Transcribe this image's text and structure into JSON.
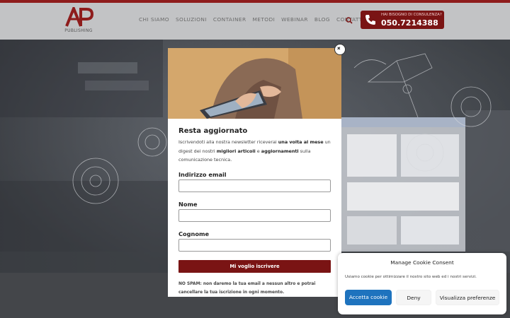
{
  "header": {
    "logo_text": "PUBLISHING",
    "nav": [
      "CHI SIAMO",
      "SOLUZIONI",
      "CONTAINER",
      "METODI",
      "WEBINAR",
      "BLOG",
      "CONTATTI"
    ],
    "cta_small": "HAI BISOGNO DI CONSULENZA?",
    "cta_phone": "050.7214388",
    "search_icon": "search-icon",
    "accent": "#7a1414"
  },
  "modal": {
    "title": "Resta aggiornato",
    "text_1": "Iscrivendoti alla nostra newsletter riceverai ",
    "text_bold_1": "una volta al mese",
    "text_2": " un digest dei nostri ",
    "text_bold_2": "migliori articoli",
    "text_3": " e ",
    "text_bold_3": "aggiornamenti",
    "text_4": " sulla comunicazione tecnica.",
    "email_label": "Indirizzo email",
    "name_label": "Nome",
    "surname_label": "Cognome",
    "submit_label": "Mi voglio iscrivere",
    "spam_note": "NO SPAM: non daremo la tua email a nessun altro e potrai cancellare la tua iscrizione in ogni momento.",
    "close_icon": "close-icon"
  },
  "cookie": {
    "title": "Manage Cookie Consent",
    "text": "Usiamo cookie per ottimizzare il nostro sito web ed i nostri servizi.",
    "accept_label": "Accetta cookie",
    "deny_label": "Deny",
    "prefs_label": "Visualizza preferenze",
    "accept_color": "#1e73be"
  }
}
